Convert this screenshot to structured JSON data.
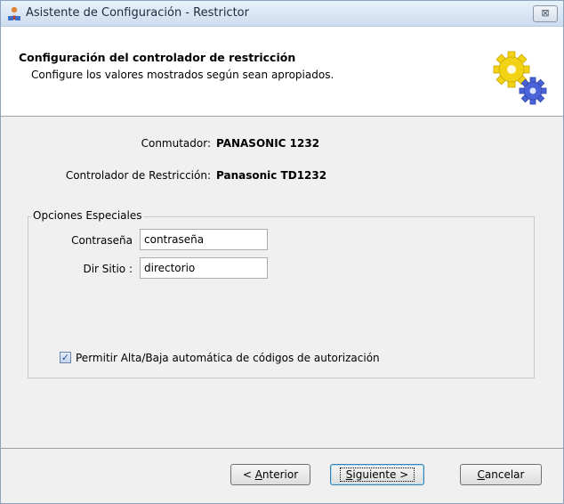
{
  "window": {
    "title": "Asistente de Configuración - Restrictor",
    "close_glyph": "⊠"
  },
  "header": {
    "title": "Configuración del controlador de restricción",
    "subtitle": "Configure los valores mostrados según sean apropiados.",
    "icon": "gears-icon"
  },
  "info": {
    "switch_label": "Conmutador:",
    "switch_value": "PANASONIC 1232",
    "controller_label": "Controlador de Restricción:",
    "controller_value": "Panasonic TD1232"
  },
  "special_options": {
    "legend": "Opciones Especiales",
    "password_label": "Contraseña",
    "password_value": "contraseña",
    "site_dir_label": "Dir Sitio  :",
    "site_dir_value": "directorio",
    "auto_checkbox_label": "Permitir Alta/Baja automática de códigos de autorización",
    "auto_checked": true
  },
  "buttons": {
    "back_prefix": "< ",
    "back_mnemonic": "A",
    "back_rest": "nterior",
    "next_mnemonic": "S",
    "next_rest": "iguiente >",
    "cancel_mnemonic": "C",
    "cancel_rest": "ancelar"
  },
  "colors": {
    "dialog_bg": "#f0f0f0",
    "title_text": "#1e2b3c",
    "gear_yellow": "#f2d214",
    "gear_blue": "#4a63d8"
  }
}
